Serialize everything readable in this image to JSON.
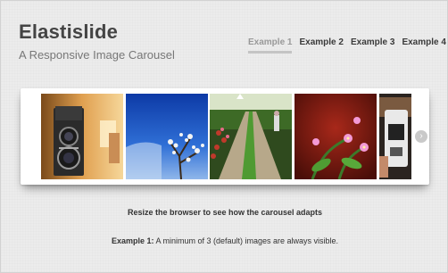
{
  "header": {
    "title": "Elastislide",
    "subtitle": "A Responsive Image Carousel"
  },
  "nav": {
    "items": [
      {
        "label": "Example 1",
        "active": true
      },
      {
        "label": "Example 2",
        "active": false
      },
      {
        "label": "Example 3",
        "active": false
      },
      {
        "label": "Example 4",
        "active": false
      }
    ]
  },
  "carousel": {
    "images": [
      {
        "name": "vintage-camera-image"
      },
      {
        "name": "flowering-tree-sky-image"
      },
      {
        "name": "garden-path-image"
      },
      {
        "name": "pink-flowers-image"
      },
      {
        "name": "partial-camera-image"
      }
    ],
    "next_icon": "chevron-right-icon"
  },
  "caption": "Resize the browser to see how the carousel adapts",
  "example": {
    "label": "Example 1:",
    "text": " A minimum of 3 (default) images are always visible."
  },
  "colors": {
    "background": "#ececec",
    "title": "#444444",
    "active_tab": "#999999"
  }
}
